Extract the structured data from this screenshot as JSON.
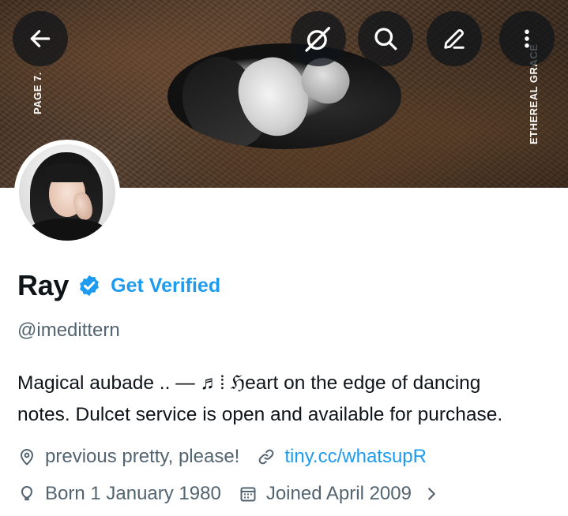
{
  "banner": {
    "left_text": "PAGE 7.",
    "right_text": "ETHEREAL GRACE"
  },
  "header_actions": {
    "back": "arrow-left-icon",
    "grok": "grok-icon",
    "search": "search-icon",
    "edit": "pencil-icon",
    "more": "more-vertical-icon"
  },
  "profile": {
    "display_name": "Ray",
    "verified_badge": "verified-badge-icon",
    "get_verified_label": "Get Verified",
    "handle": "@imedittern",
    "bio_line_1": "Magical aubade .. — ♬⁞ ℌeart on the edge of dancing",
    "bio_line_2": "notes. Dulcet service is open and available for purchase.",
    "location": "previous pretty, please!",
    "website": "tiny.cc/whatsupR",
    "birthday": "Born 1 January 1980",
    "joined": "Joined April 2009"
  },
  "colors": {
    "accent": "#1d9bf0",
    "text_primary": "#0f1419",
    "text_secondary": "#536471",
    "header_button_bg": "#0f1419"
  }
}
